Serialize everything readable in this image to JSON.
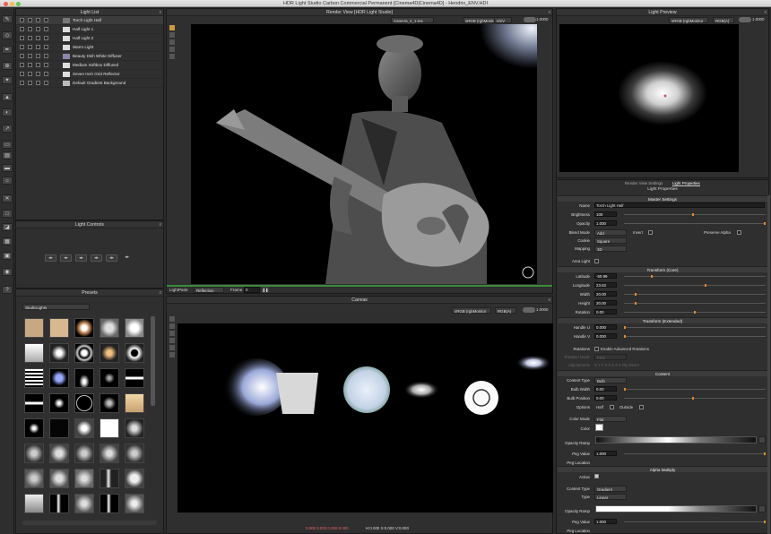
{
  "window": {
    "title": "HDR Light Studio Carbon Commercial Permanent [Cinema4D|Cinema4D] - Hendrix_ENV.HDI"
  },
  "light_list": {
    "title": "Light List",
    "items": [
      "Torch Light Half",
      "Half Light 1",
      "Half Light 2",
      "Warm Light",
      "Beauty Dish White Diffuser",
      "Medium Softbox Diffused",
      "Seven Inch Grid Reflector",
      "Default Gradient Background"
    ],
    "selected": 0
  },
  "light_controls": {
    "title": "Light Controls",
    "close": "x"
  },
  "presets": {
    "title": "Presets",
    "category": "StudioLights",
    "rows": 11,
    "cols": 6
  },
  "render_view": {
    "title": "Render View [HDR Light Studio]",
    "camera": "Camera_4_1-Ins",
    "color_space": "sRGB (rgbMonitor",
    "channel": "HSV",
    "exposure": "1.0000"
  },
  "lightpaint": {
    "label": "LightPaint",
    "mode": "Reflection",
    "frame_label": "Frame",
    "frame": "0"
  },
  "canvas": {
    "title": "Canvas",
    "color_space": "sRGB (rgbMonitor",
    "channel": "RGB(A)",
    "exposure": "1.0000",
    "status_rgb": "0.000  0.000  0.000  0.000",
    "status_hsv": "H:0.000  S:0.000  V:0.000"
  },
  "light_preview": {
    "title": "Light Preview",
    "color_space": "sRGB (rgbMonitor",
    "channel": "RGB(A)",
    "exposure": "1.0000"
  },
  "props": {
    "tab_render": "Render View Settings",
    "tab_light": "Light Properties",
    "header": "Light Properties",
    "master": "Master Settings",
    "name_l": "Name",
    "name": "Torch Light Half",
    "bright_l": "Brightness",
    "bright": "100",
    "opac_l": "Opacity",
    "opac": "1.000",
    "blend_l": "Blend Mode",
    "blend": "Add",
    "invert": "Invert",
    "preserve": "Preserve Alpha",
    "cookie_l": "Cookie",
    "cookie": "Square",
    "map_l": "Mapping",
    "map": "3D",
    "area_l": "Area Light",
    "tcore": "Transform (Core)",
    "lat_l": "Latitude",
    "lat": "-50.99",
    "lon_l": "Longitude",
    "lon": "23.63",
    "w_l": "Width",
    "w": "20.00",
    "h_l": "Height",
    "h": "20.00",
    "rot_l": "Rotation",
    "rot": "0.00",
    "text": "Transform (Extended)",
    "hu_l": "Handle U",
    "hu": "0.000",
    "hv_l": "Handle V",
    "hv": "0.000",
    "rots_l": "Rotations",
    "rots": "Enable Advanced Rotations",
    "rmode_l": "Rotation Mode",
    "rmode": "Free",
    "adj_l": "Adjustments",
    "adj": "X Y  Y X  X Z  Z X  Flip  Reset",
    "content": "Content",
    "ctype_l": "Content Type",
    "ctype": "Bulb",
    "bw_l": "Bulb Width",
    "bw": "0.00",
    "bp_l": "Bulb Position",
    "bp": "0.00",
    "opts_l": "Options",
    "half": "Half",
    "outside": "Outside",
    "cmode_l": "Color Mode",
    "cmode": "Flat",
    "color_l": "Color",
    "oramp_l": "Opacity Ramp",
    "pval_l": "Peg Value",
    "pval": "1.000",
    "ploc_l": "Peg Location",
    "alpha": "Alpha Multiply",
    "active_l": "Active",
    "ctype2_l": "Content Type",
    "ctype2": "Gradient",
    "type_l": "Type",
    "type": "Linear",
    "oramp2_l": "Opacity Ramp",
    "pval2_l": "Peg Value",
    "pval2": "1.000",
    "ploc2_l": "Peg Location"
  },
  "colors": {
    "accent": "#e08a2a",
    "canvas_bg": "#000000",
    "panel": "#2f2f2f"
  }
}
